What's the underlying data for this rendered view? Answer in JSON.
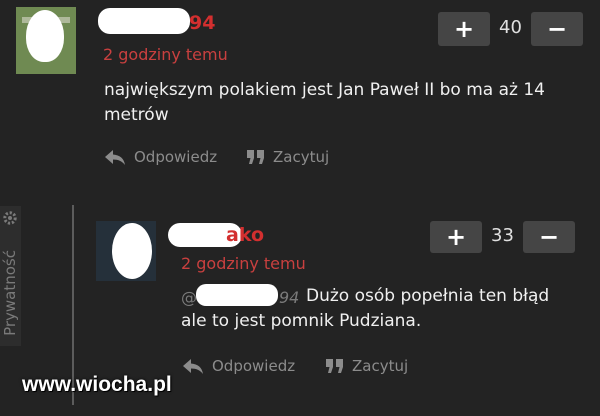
{
  "comments": [
    {
      "author_suffix": "94",
      "time": "2 godziny temu",
      "text": "największym polakiem jest Jan Paweł II bo ma aż 14 metrów",
      "plus": "+",
      "minus": "−",
      "votes": "40",
      "reply_label": "Odpowiedz",
      "quote_label": "Zacytuj"
    },
    {
      "author_suffix": "ako",
      "time": "2 godziny temu",
      "mention_prefix": "@",
      "mention_suffix": "94",
      "text": "Dużo osób popełnia ten błąd ale to jest pomnik Pudziana.",
      "plus": "+",
      "minus": "−",
      "votes": "33",
      "reply_label": "Odpowiedz",
      "quote_label": "Zacytuj"
    }
  ],
  "privacy_label": "Prywatność",
  "watermark": "www.wiocha.pl",
  "icons": {
    "reply": "reply-arrow-icon",
    "quote": "quote-icon",
    "privacy": "gear-icon"
  },
  "colors": {
    "background": "#232323",
    "username": "#d32f2f",
    "timestamp": "#c9403f",
    "vote_button": "#454545"
  }
}
